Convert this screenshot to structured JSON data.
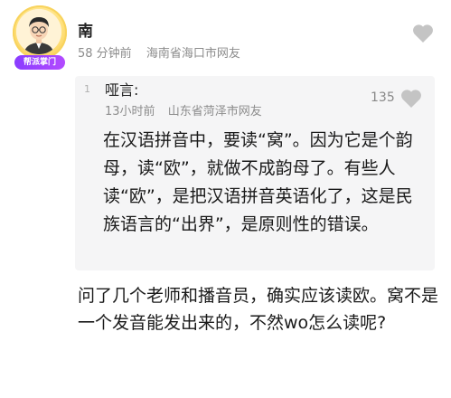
{
  "comment": {
    "author": "南",
    "time": "58 分钟前",
    "location": "海南省海口市网友",
    "badge": "帮派掌门",
    "text": "问了几个老师和播音员，确实应该读欧。窝不是一个发音能发出来的，不然wo怎么读呢?"
  },
  "reply": {
    "index": "1",
    "author": "哑言:",
    "time": "13小时前",
    "location": "山东省菏泽市网友",
    "likes": "135",
    "text": "在汉语拼音中，要读“窝”。因为它是个韵母，读“欧”，就做不成韵母了。有些人读“欧”，是把汉语拼音英语化了，这是民族语言的“出界”，是原则性的错误。"
  },
  "icons": {
    "like_top": "heart-icon",
    "like_reply": "heart-icon"
  },
  "colors": {
    "badge": "#8a3cff",
    "heart": "#c4c4c4",
    "reply_bg": "#f5f5f6",
    "meta_text": "#8c8c8c"
  }
}
